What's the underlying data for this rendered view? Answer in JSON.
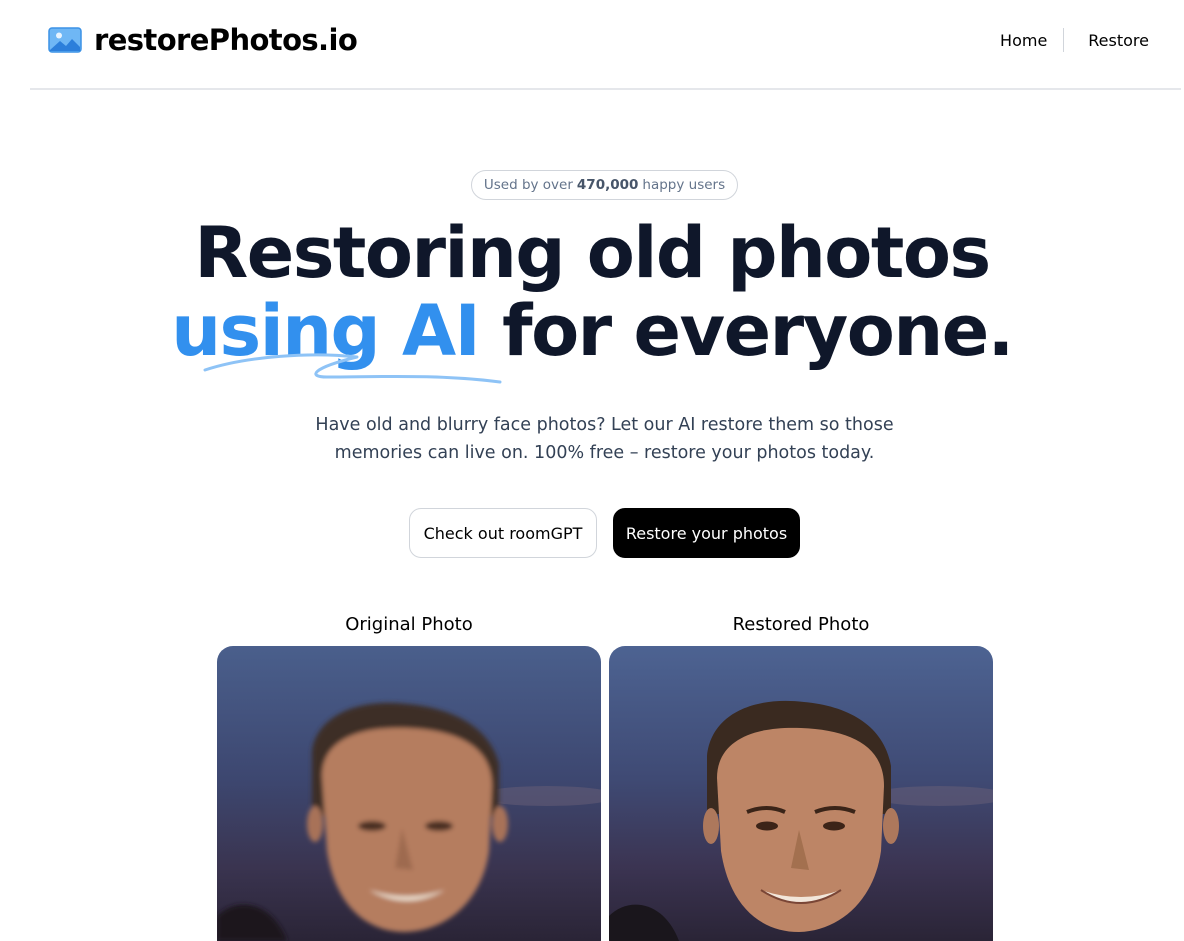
{
  "header": {
    "brand": "restorePhotos.io",
    "nav": [
      {
        "label": "Home"
      },
      {
        "label": "Restore"
      }
    ]
  },
  "hero": {
    "badge": {
      "prefix": "Used by over",
      "count": "470,000",
      "suffix": "happy users"
    },
    "title_line1": "Restoring old photos",
    "title_accent": "using AI",
    "title_rest": "for everyone.",
    "subtitle": "Have old and blurry face photos? Let our AI restore them so those memories can live on. 100% free – restore your photos today.",
    "buttons": {
      "secondary": "Check out roomGPT",
      "primary": "Restore your photos"
    }
  },
  "comparison": {
    "original_label": "Original Photo",
    "restored_label": "Restored Photo"
  },
  "colors": {
    "accent": "#3290ee",
    "text": "#0f172a",
    "button_primary": "#000000"
  },
  "icons": {
    "brand": "photo-icon"
  }
}
